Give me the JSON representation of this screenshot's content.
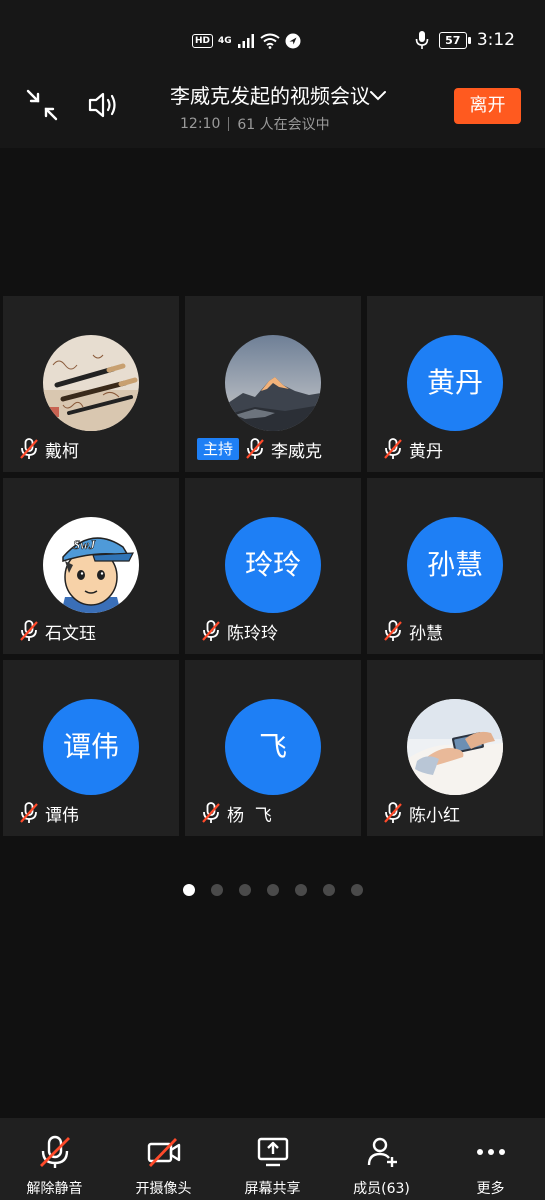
{
  "status_bar": {
    "hd": "HD",
    "network": "4G",
    "battery": "57",
    "time": "3:12"
  },
  "header": {
    "title": "李威克发起的视频会议",
    "meeting_time": "12:10",
    "participants_text": "61 人在会议中",
    "leave_label": "离开"
  },
  "participants": [
    {
      "name": "戴柯",
      "avatar_type": "photo-calligraphy-brushes",
      "muted": true
    },
    {
      "name": "李威克",
      "avatar_type": "photo-snow-mountain",
      "muted": true,
      "host_badge": "主持"
    },
    {
      "name": "黄丹",
      "avatar_text": "黄丹",
      "muted": true
    },
    {
      "name": "石文珏",
      "avatar_type": "cartoon-boy-cap",
      "cap_text": "SwJ",
      "muted": true
    },
    {
      "name": "陈玲玲",
      "avatar_text": "玲玲",
      "muted": true
    },
    {
      "name": "孙慧",
      "avatar_text": "孙慧",
      "muted": true
    },
    {
      "name": "谭伟",
      "avatar_text": "谭伟",
      "muted": true
    },
    {
      "name": "杨  飞",
      "avatar_text": "飞",
      "muted": true
    },
    {
      "name": "陈小红",
      "avatar_type": "photo-hands-phone",
      "muted": true
    }
  ],
  "pager": {
    "total": 7,
    "current": 1
  },
  "toolbar": {
    "unmute": "解除静音",
    "camera": "开摄像头",
    "share": "屏幕共享",
    "members": "成员(63)",
    "more": "更多"
  },
  "colors": {
    "accent_blue": "#1e7ff5",
    "leave_orange": "#ff5a1f",
    "mute_red": "#ff4a2a",
    "tile_bg": "#212121"
  }
}
